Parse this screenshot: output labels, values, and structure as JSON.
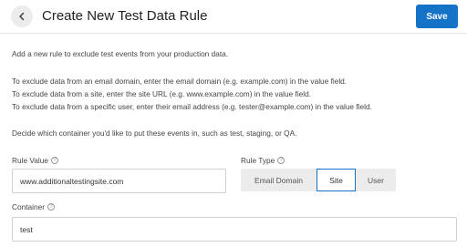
{
  "header": {
    "back_icon": "chevron-left-icon",
    "title": "Create New Test Data Rule",
    "save_label": "Save",
    "accent_color": "#1473c6"
  },
  "instructions": {
    "intro": "Add a new rule to exclude test events from your production data.",
    "email_domain": "To exclude data from an email domain, enter the email domain (e.g. example.com) in the value field.",
    "site": "To exclude data from a site, enter the site URL (e.g. www.example.com) in the value field.",
    "user": "To exclude data from a specific user, enter their email address (e.g. tester@example.com) in the value field.",
    "container": "Decide which container you'd like to put these events in, such as test, staging, or QA."
  },
  "rule_value": {
    "label": "Rule Value",
    "help_icon": "question-circle-icon",
    "value": "www.additionaltestingsite.com"
  },
  "rule_type": {
    "label": "Rule Type",
    "help_icon": "question-circle-icon",
    "options": [
      "Email Domain",
      "Site",
      "User"
    ],
    "selected": "Site"
  },
  "container": {
    "label": "Container",
    "help_icon": "question-circle-icon",
    "value": "test"
  }
}
